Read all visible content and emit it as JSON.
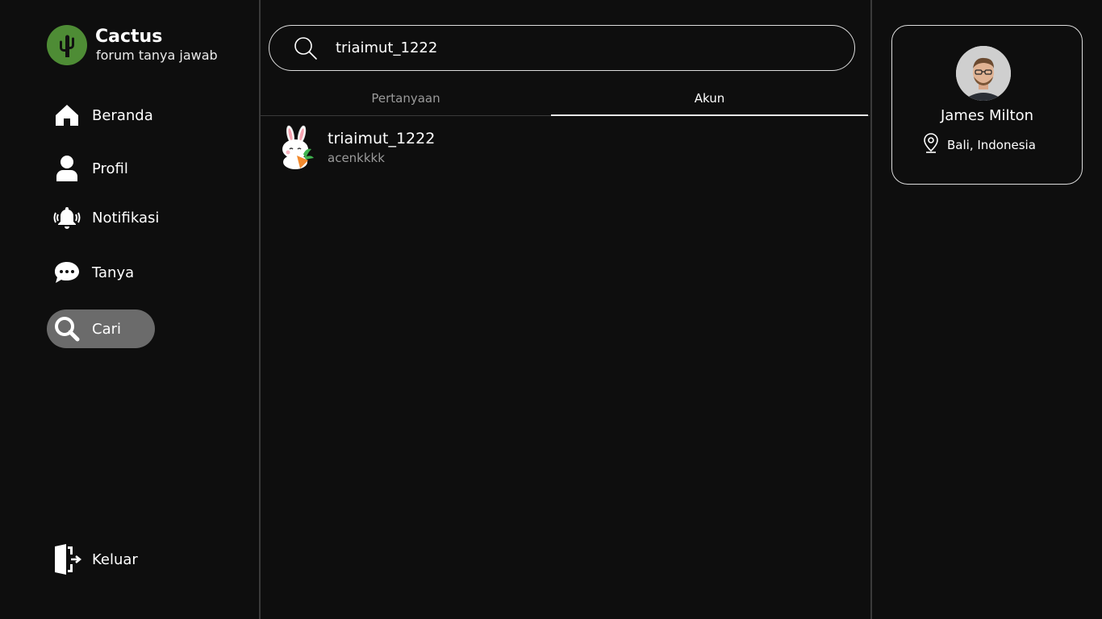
{
  "brand": {
    "title": "Cactus",
    "subtitle": "forum tanya jawab",
    "color": "#4e8c35"
  },
  "nav": {
    "items": [
      {
        "label": "Beranda",
        "icon": "home-icon"
      },
      {
        "label": "Profil",
        "icon": "user-icon"
      },
      {
        "label": "Notifikasi",
        "icon": "bell-icon"
      },
      {
        "label": "Tanya",
        "icon": "chat-icon"
      },
      {
        "label": "Cari",
        "icon": "search-icon",
        "active": true
      }
    ],
    "logout": {
      "label": "Keluar",
      "icon": "logout-icon"
    }
  },
  "search": {
    "value": "triaimut_1222",
    "icon": "search-icon"
  },
  "tabs": [
    {
      "label": "Pertanyaan",
      "active": false
    },
    {
      "label": "Akun",
      "active": true
    }
  ],
  "results": [
    {
      "username": "triaimut_1222",
      "name": "acenkkkk",
      "avatar": "bunny-avatar-icon"
    }
  ],
  "profile": {
    "name": "James Milton",
    "location": "Bali, Indonesia",
    "location_icon": "map-pin-icon"
  },
  "colors": {
    "background": "#0e0e0e",
    "active_nav": "#6b6b6b",
    "muted_text": "#9a9a9a",
    "divider": "#3a3a3a"
  }
}
